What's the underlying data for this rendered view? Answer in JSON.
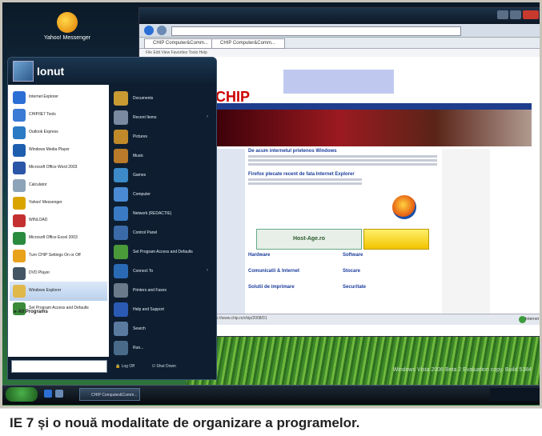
{
  "caption": "IE 7 și o nouă modalitate de organizare a programelor.",
  "desktop": {
    "icon_label": "Yahoo! Messenger"
  },
  "browser": {
    "tabs": [
      "CHIP Computer&Comm...",
      "CHIP Computer&Comm..."
    ],
    "menu_text": "File  Edit  View  Favorites  Tools  Help",
    "status_text": "http://www.chip.ro/chip/2008/01",
    "status_zone": "Internet",
    "page": {
      "logo": "CHIP",
      "headlines": [
        "De acum internetul prietenos Windows",
        "Firefox plecate recent de fata Internet Explorer"
      ],
      "ad_text": "Host-Age.ro",
      "sections": [
        "Hardware",
        "Software",
        "Comunicatii & Internet",
        "Stocare",
        "Solutii de imprimare",
        "Securitate"
      ]
    }
  },
  "start_menu": {
    "user": "Ionut",
    "programs": [
      {
        "label": "Internet Explorer",
        "color": "#2c6fd4"
      },
      {
        "label": "CHIP/IE7 Tools",
        "color": "#3a7bd5"
      },
      {
        "label": "Outlook Express",
        "color": "#2a7ac4"
      },
      {
        "label": "Windows Media Player",
        "color": "#1d5fae"
      },
      {
        "label": "Microsoft Office Word 2003",
        "color": "#2b55a6"
      },
      {
        "label": "Calculator",
        "color": "#8da3b8"
      },
      {
        "label": "Yahoo! Messenger",
        "color": "#d9a400"
      },
      {
        "label": "WINLOAD",
        "color": "#c43030"
      },
      {
        "label": "Microsoft Office Excel 2003",
        "color": "#2a8a3e"
      },
      {
        "label": "Turn CHIP Settings On or Off",
        "color": "#e8a21c"
      },
      {
        "label": "DVD Player",
        "color": "#445566"
      },
      {
        "label": "Windows Explorer",
        "color": "#e0b84a"
      },
      {
        "label": "Set Program Access and Defaults",
        "color": "#3a8a3a"
      }
    ],
    "all_programs": "All Programs",
    "places": [
      {
        "label": "Documents",
        "color": "#c79a32",
        "arrow": ""
      },
      {
        "label": "Recent Items",
        "color": "#7a8aa0",
        "arrow": "›"
      },
      {
        "label": "Pictures",
        "color": "#c08a2a",
        "arrow": ""
      },
      {
        "label": "Music",
        "color": "#b97a2a",
        "arrow": ""
      },
      {
        "label": "Games",
        "color": "#3c8ac8",
        "arrow": ""
      },
      {
        "label": "Computer",
        "color": "#4a8ad4",
        "arrow": ""
      },
      {
        "label": "Network (REDACTIE)",
        "color": "#3a7ac4",
        "arrow": ""
      },
      {
        "label": "Control Panel",
        "color": "#3a6aa8",
        "arrow": ""
      },
      {
        "label": "Set Program Access and Defaults",
        "color": "#4a9a3a",
        "arrow": ""
      },
      {
        "label": "Connect To",
        "color": "#2a6ab4",
        "arrow": "›"
      },
      {
        "label": "Printers and Faxes",
        "color": "#6a7a8a",
        "arrow": ""
      },
      {
        "label": "Help and Support",
        "color": "#2a5ab4",
        "arrow": ""
      },
      {
        "label": "Search",
        "color": "#5a7aa0",
        "arrow": ""
      },
      {
        "label": "Run...",
        "color": "#4a6a8a",
        "arrow": ""
      }
    ],
    "log_off": "Log Off",
    "shut_down": "Shut Down"
  },
  "taskbar": {
    "start_label": "start",
    "task_label": "CHIP Computer&Comm...",
    "watermark": "Windows Vista 2006 Beta 2 Evaluation copy. Build 5384"
  }
}
